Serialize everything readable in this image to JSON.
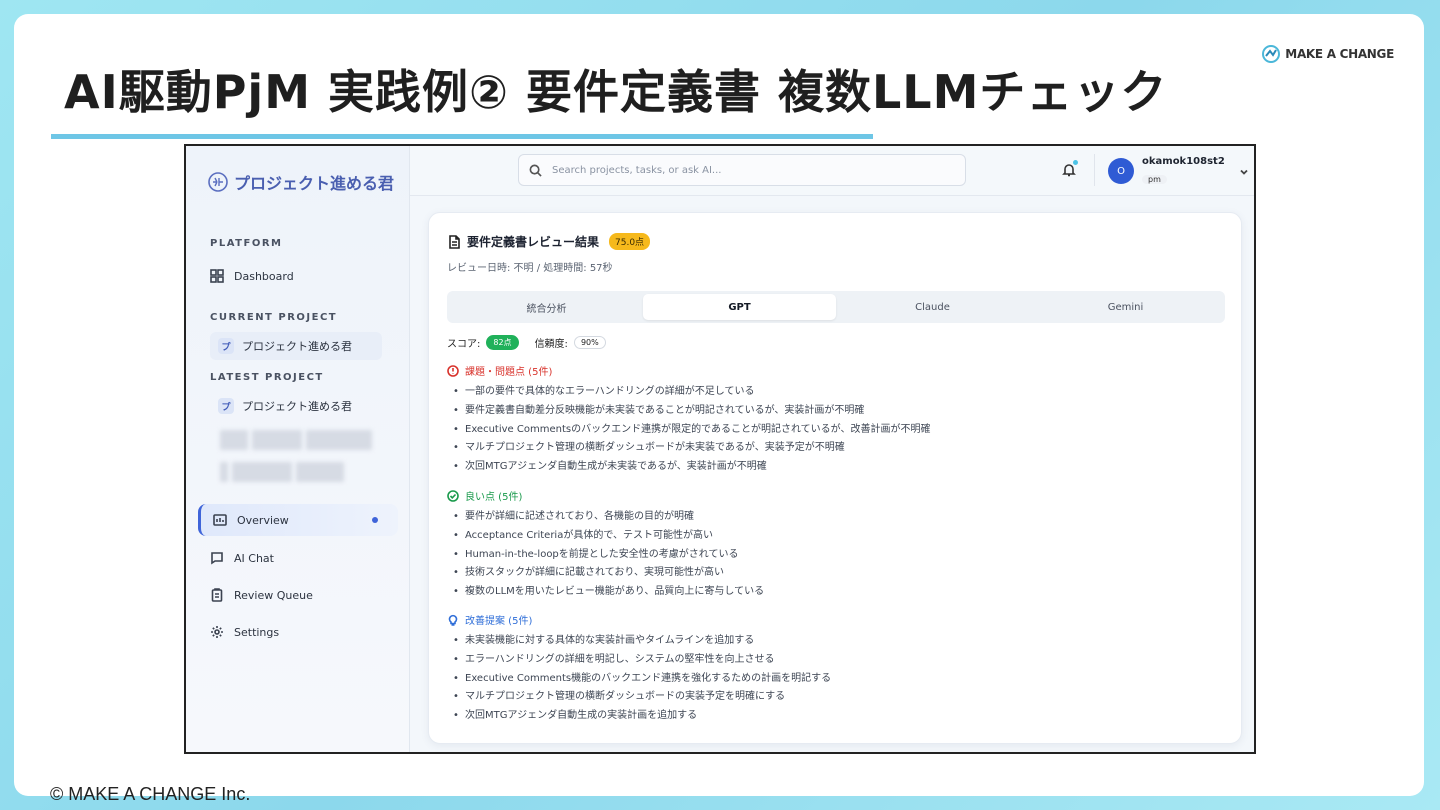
{
  "slide": {
    "title": "AI駆動PjM 実践例② 要件定義書 複数LLMチェック",
    "brand": "MAKE A CHANGE",
    "copyright": "© MAKE A CHANGE Inc.",
    "accent_color": "#6ec6e6"
  },
  "app": {
    "logo_text": "プロジェクト進める君",
    "search": {
      "placeholder": "Search projects, tasks, or ask AI..."
    },
    "user": {
      "initial": "O",
      "name": "okamok108st2",
      "role": "pm"
    },
    "sidebar": {
      "platform_label": "PLATFORM",
      "dashboard": "Dashboard",
      "current_project_label": "CURRENT PROJECT",
      "current_project": {
        "badge": "プ",
        "name": "プロジェクト進める君"
      },
      "latest_project_label": "LATEST PROJECT",
      "latest_project": {
        "badge": "プ",
        "name": "プロジェクト進める君"
      },
      "nav": {
        "overview": "Overview",
        "ai_chat": "AI Chat",
        "review_queue": "Review Queue",
        "settings": "Settings"
      }
    },
    "review": {
      "title": "要件定義書レビュー結果",
      "score_badge": "75.0点",
      "meta": "レビュー日時: 不明 / 処理時間: 57秒",
      "tabs": [
        "統合分析",
        "GPT",
        "Claude",
        "Gemini"
      ],
      "active_tab": "GPT",
      "score_label": "スコア:",
      "score_value": "82点",
      "confidence_label": "信頼度:",
      "confidence_value": "90%",
      "issues": {
        "heading": "課題・問題点 (5件)",
        "items": [
          "一部の要件で具体的なエラーハンドリングの詳細が不足している",
          "要件定義書自動差分反映機能が未実装であることが明記されているが、実装計画が不明確",
          "Executive Commentsのバックエンド連携が限定的であることが明記されているが、改善計画が不明確",
          "マルチプロジェクト管理の横断ダッシュボードが未実装であるが、実装予定が不明確",
          "次回MTGアジェンダ自動生成が未実装であるが、実装計画が不明確"
        ]
      },
      "strengths": {
        "heading": "良い点 (5件)",
        "items": [
          "要件が詳細に記述されており、各機能の目的が明確",
          "Acceptance Criteriaが具体的で、テスト可能性が高い",
          "Human-in-the-loopを前提とした安全性の考慮がされている",
          "技術スタックが詳細に記載されており、実現可能性が高い",
          "複数のLLMを用いたレビュー機能があり、品質向上に寄与している"
        ]
      },
      "suggestions": {
        "heading": "改善提案 (5件)",
        "items": [
          "未実装機能に対する具体的な実装計画やタイムラインを追加する",
          "エラーハンドリングの詳細を明記し、システムの堅牢性を向上させる",
          "Executive Comments機能のバックエンド連携を強化するための計画を明記する",
          "マルチプロジェクト管理の横断ダッシュボードの実装予定を明確にする",
          "次回MTGアジェンダ自動生成の実装計画を追加する"
        ]
      }
    }
  }
}
